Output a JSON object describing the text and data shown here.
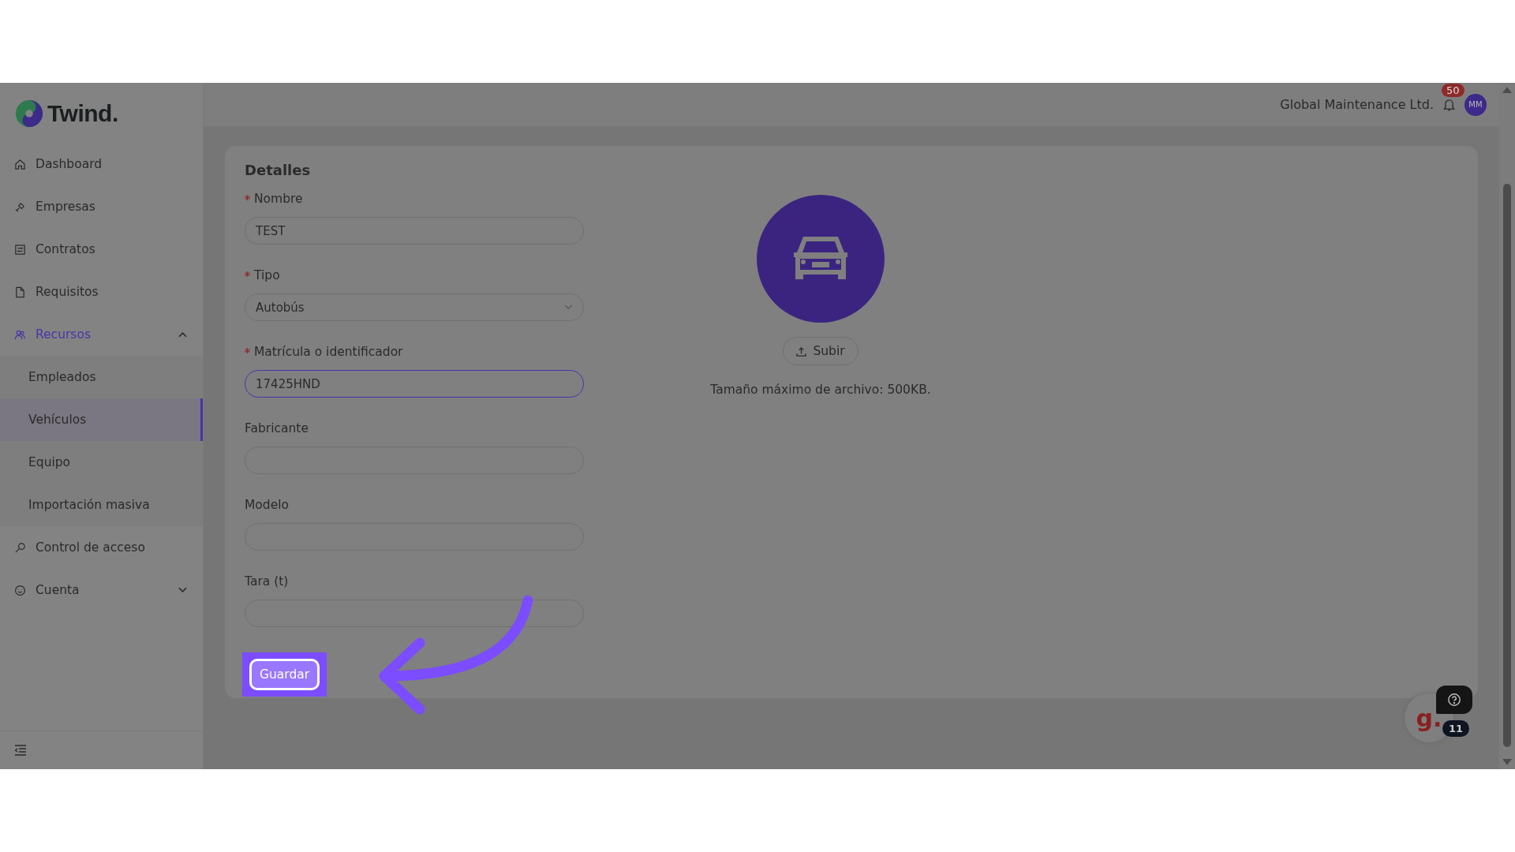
{
  "logo": {
    "text": "Twind."
  },
  "sidebar": {
    "items": [
      {
        "label": "Dashboard",
        "selected": false
      },
      {
        "label": "Empresas",
        "selected": false
      },
      {
        "label": "Contratos",
        "selected": false
      },
      {
        "label": "Requisitos",
        "selected": false
      },
      {
        "label": "Recursos",
        "selected": true,
        "expanded": true,
        "children": [
          {
            "label": "Empleados",
            "selected": false
          },
          {
            "label": "Vehículos",
            "selected": true
          },
          {
            "label": "Equipo",
            "selected": false
          },
          {
            "label": "Importación masiva",
            "selected": false
          }
        ]
      },
      {
        "label": "Control de acceso",
        "selected": false
      },
      {
        "label": "Cuenta",
        "selected": false,
        "expanded": false
      }
    ]
  },
  "header": {
    "company": "Global Maintenance Ltd.",
    "notifications": "50",
    "avatar": "MM"
  },
  "form": {
    "title": "Detalles",
    "fields": [
      {
        "label": "Nombre",
        "required": true,
        "kind": "text",
        "value": "TEST",
        "focused": false
      },
      {
        "label": "Tipo",
        "required": true,
        "kind": "select",
        "value": "Autobús",
        "focused": false
      },
      {
        "label": "Matrícula o identificador",
        "required": true,
        "kind": "text",
        "value": "17425HND",
        "focused": true
      },
      {
        "label": "Fabricante",
        "required": false,
        "kind": "text",
        "focused": false
      },
      {
        "label": "Modelo",
        "required": false,
        "kind": "text",
        "focused": false
      },
      {
        "label": "Tara (t)",
        "required": false,
        "kind": "text",
        "focused": false
      }
    ],
    "save_button": {
      "label": "Guardar",
      "highlighted": true
    }
  },
  "upload": {
    "button": "Subir",
    "note": "Tamaño máximo de archivo: 500KB."
  },
  "help_widget": {
    "logo": "g.",
    "badge": "11"
  }
}
